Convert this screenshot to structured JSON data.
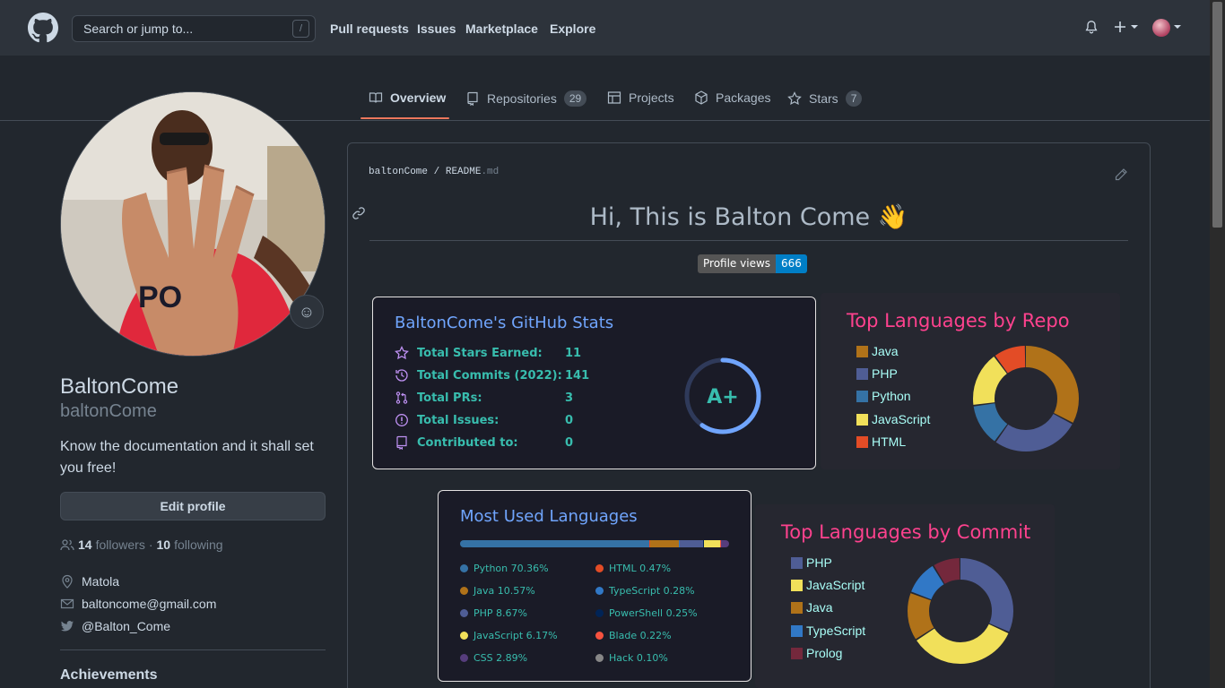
{
  "header": {
    "search_placeholder": "Search or jump to...",
    "search_shortcut": "/",
    "nav": [
      "Pull requests",
      "Issues",
      "Marketplace",
      "Explore"
    ],
    "icons": [
      "bell-icon",
      "plus-icon",
      "avatar"
    ]
  },
  "tabs": [
    {
      "label": "Overview",
      "icon": "book-icon",
      "active": true
    },
    {
      "label": "Repositories",
      "icon": "repo-icon",
      "count": "29"
    },
    {
      "label": "Projects",
      "icon": "table-icon"
    },
    {
      "label": "Packages",
      "icon": "package-icon"
    },
    {
      "label": "Stars",
      "icon": "star-icon",
      "count": "7"
    }
  ],
  "profile": {
    "name": "BaltonCome",
    "login": "baltonCome",
    "bio": "Know the documentation and it shall set you free!",
    "edit_label": "Edit profile",
    "followers": "14",
    "followers_label": "followers",
    "following": "10",
    "following_label": "following",
    "sep": "·",
    "location": "Matola",
    "email": "baltoncome@gmail.com",
    "twitter": "@Balton_Come",
    "achievements": "Achievements"
  },
  "readme": {
    "owner": "baltonCome",
    "slash": "/",
    "file": "README",
    "ext": ".md",
    "heading": "Hi, This is Balton Come 👋",
    "badge_label": "Profile views",
    "badge_value": "666"
  },
  "stats": {
    "title": "BaltonCome's GitHub Stats",
    "rows": [
      {
        "label": "Total Stars Earned:",
        "value": "11",
        "icon": "star-icon"
      },
      {
        "label": "Total Commits (2022):",
        "value": "141",
        "icon": "history-icon"
      },
      {
        "label": "Total PRs:",
        "value": "3",
        "icon": "pr-icon"
      },
      {
        "label": "Total Issues:",
        "value": "0",
        "icon": "issue-icon"
      },
      {
        "label": "Contributed to:",
        "value": "0",
        "icon": "repo-icon"
      }
    ],
    "grade": "A+"
  },
  "top_repo": {
    "title": "Top Languages by Repo",
    "legend": [
      "Java",
      "PHP",
      "Python",
      "JavaScript",
      "HTML"
    ],
    "colors": [
      "#b07219",
      "#4f5d95",
      "#3572a5",
      "#f1e05a",
      "#e34c26"
    ],
    "shares": [
      0.33,
      0.27,
      0.13,
      0.17,
      0.1
    ]
  },
  "most_used": {
    "title": "Most Used Languages",
    "langs": [
      {
        "name": "Python 70.36%",
        "color": "#3572a5",
        "pct": 70.36
      },
      {
        "name": "HTML 0.47%",
        "color": "#e34c26",
        "pct": 0.47
      },
      {
        "name": "Java 10.57%",
        "color": "#b07219",
        "pct": 10.57
      },
      {
        "name": "TypeScript 0.28%",
        "color": "#3178c6",
        "pct": 0.28
      },
      {
        "name": "PHP 8.67%",
        "color": "#4f5d95",
        "pct": 8.67
      },
      {
        "name": "PowerShell 0.25%",
        "color": "#012456",
        "pct": 0.25
      },
      {
        "name": "JavaScript 6.17%",
        "color": "#f1e05a",
        "pct": 6.17
      },
      {
        "name": "Blade 0.22%",
        "color": "#f7523f",
        "pct": 0.22
      },
      {
        "name": "CSS 2.89%",
        "color": "#563d7c",
        "pct": 2.89
      },
      {
        "name": "Hack 0.10%",
        "color": "#878787",
        "pct": 0.1
      }
    ]
  },
  "top_commit": {
    "title": "Top Languages by Commit",
    "legend": [
      "PHP",
      "JavaScript",
      "Java",
      "TypeScript",
      "Prolog"
    ],
    "colors": [
      "#4f5d95",
      "#f1e05a",
      "#b07219",
      "#3178c6",
      "#74283c"
    ],
    "shares": [
      0.3,
      0.32,
      0.14,
      0.1,
      0.08
    ]
  }
}
